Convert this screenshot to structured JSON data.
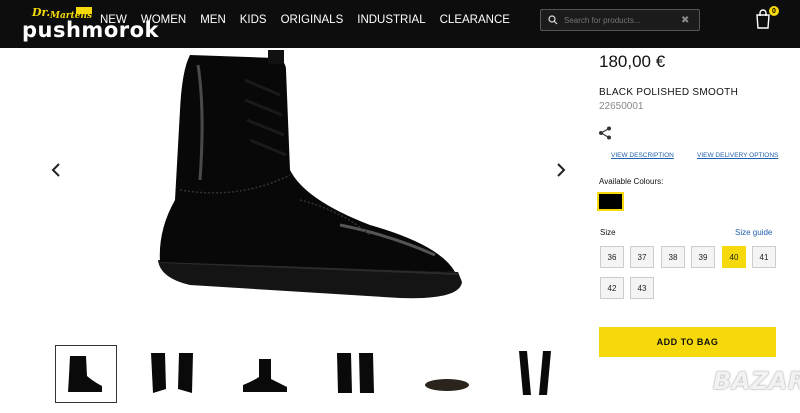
{
  "header": {
    "watermark_top": "pushmorok",
    "nav": [
      "NEW",
      "WOMEN",
      "MEN",
      "KIDS",
      "ORIGINALS",
      "INDUSTRIAL",
      "CLEARANCE"
    ],
    "search_placeholder": "Search for products...",
    "search_clear": "✖",
    "cart_count": "0"
  },
  "product": {
    "price": "180,00 €",
    "name": "BLACK POLISHED SMOOTH",
    "sku": "22650001",
    "view_description": "VIEW DESCRIPTION",
    "view_delivery": "VIEW DELIVERY OPTIONS",
    "available_colours_label": "Available Colours:",
    "size_label": "Size",
    "size_guide": "Size guide",
    "sizes": [
      "36",
      "37",
      "38",
      "39",
      "40",
      "41",
      "42",
      "43"
    ],
    "selected_size": "40",
    "add_to_bag": "ADD TO BAG"
  },
  "colors": {
    "accent": "#f5d90a",
    "header_bg": "#0d0d0d",
    "link": "#1f5fae"
  },
  "watermark_bottom": "BAZAR"
}
